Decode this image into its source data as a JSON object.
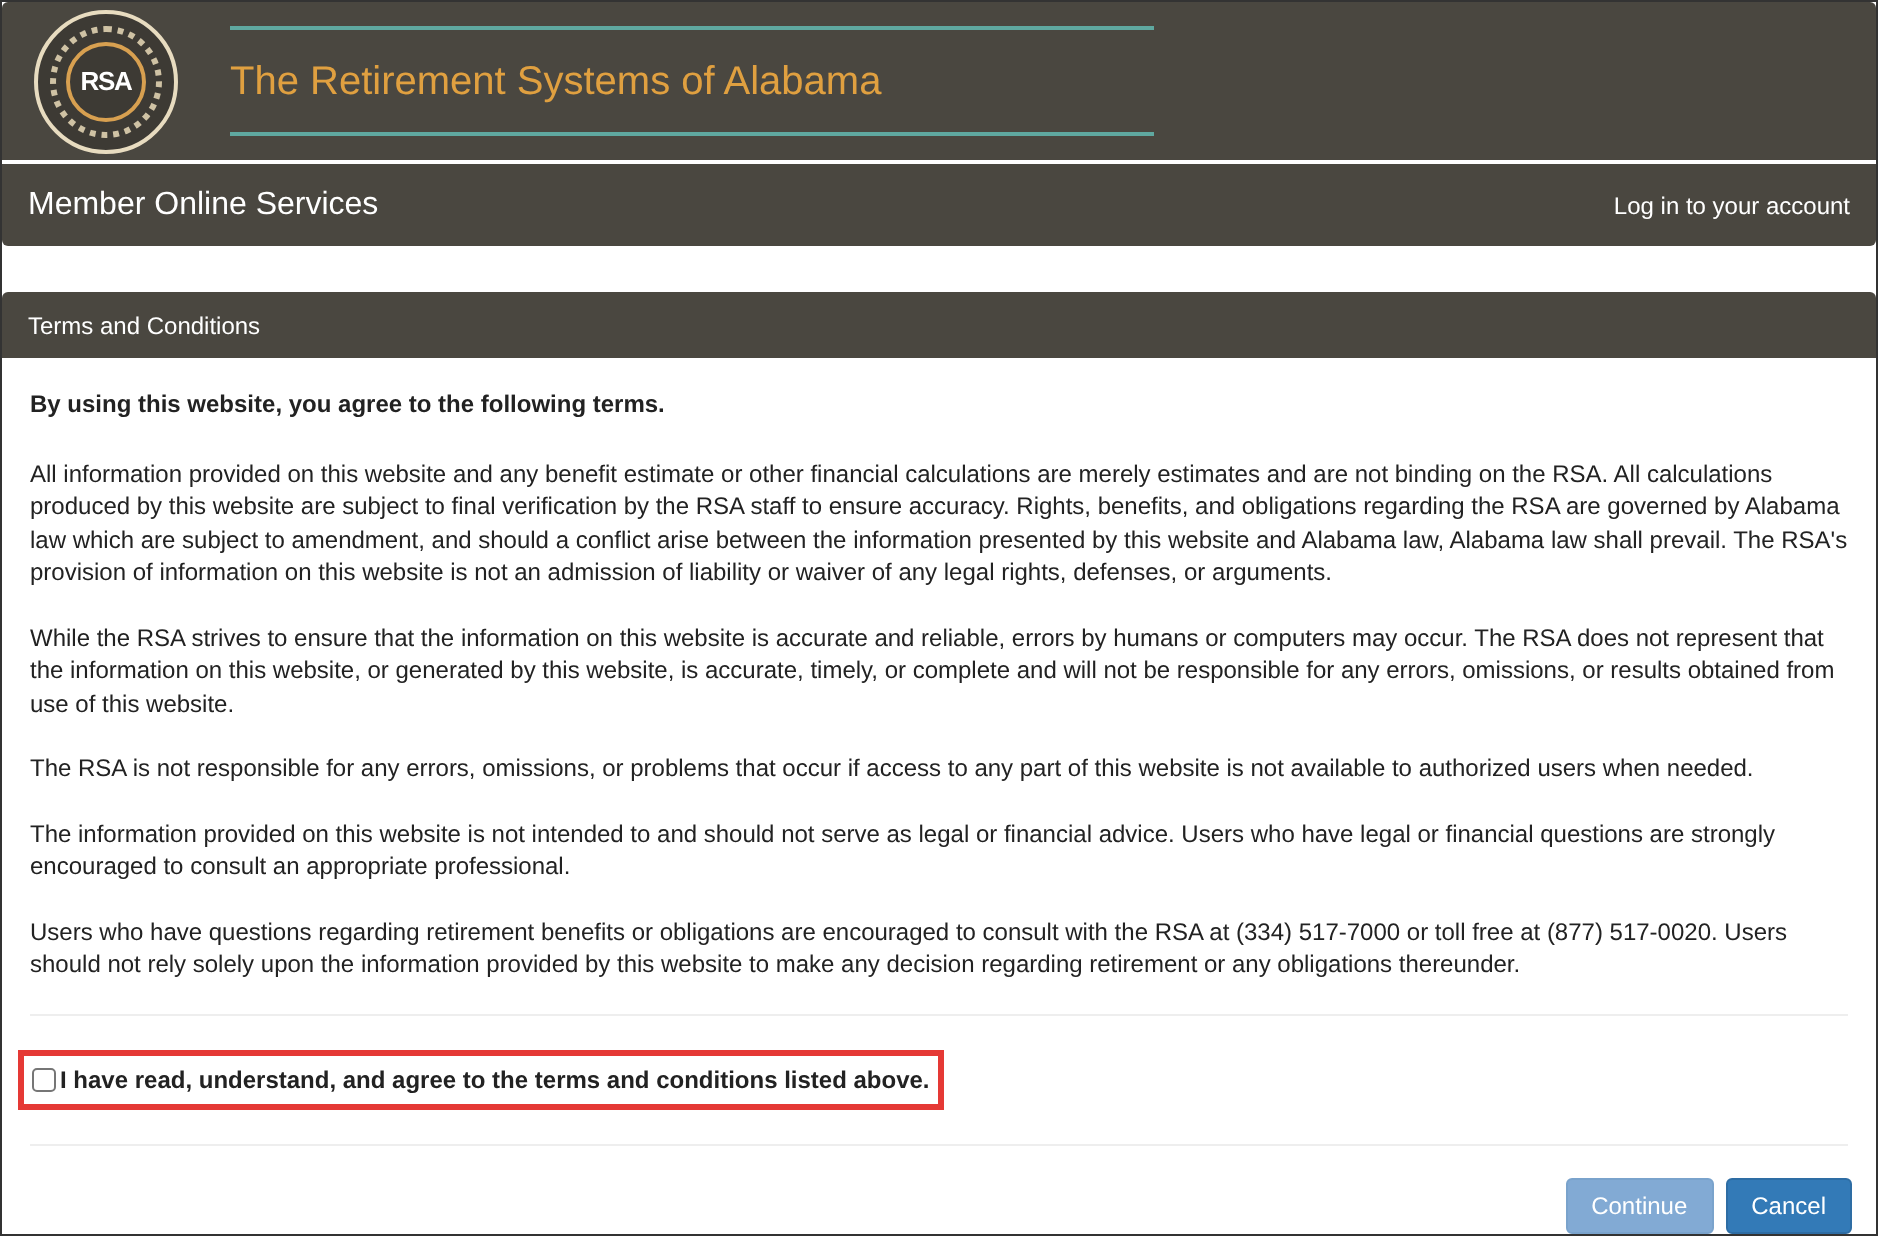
{
  "header": {
    "logo_monogram": "RSA",
    "title": "The Retirement Systems of Alabama"
  },
  "navbar": {
    "brand": "Member Online Services",
    "login_link": "Log in to your account"
  },
  "panel": {
    "title": "Terms and Conditions",
    "intro": "By using this website, you agree to the following terms.",
    "paragraphs": [
      "All information provided on this website and any benefit estimate or other financial calculations are merely estimates and are not binding on the RSA. All calculations produced by this website are subject to final verification by the RSA staff to ensure accuracy. Rights, benefits, and obligations regarding the RSA are governed by Alabama law which are subject to amendment, and should a conflict arise between the information presented by this website and Alabama law, Alabama law shall prevail. The RSA's provision of information on this website is not an admission of liability or waiver of any legal rights, defenses, or arguments.",
      "While the RSA strives to ensure that the information on this website is accurate and reliable, errors by humans or computers may occur. The RSA does not represent that the information on this website, or generated by this website, is accurate, timely, or complete and will not be responsible for any errors, omissions, or results obtained from use of this website.",
      "The RSA is not responsible for any errors, omissions, or problems that occur if access to any part of this website is not available to authorized users when needed.",
      "The information provided on this website is not intended to and should not serve as legal or financial advice. Users who have legal or financial questions are strongly encouraged to consult an appropriate professional.",
      "Users who have questions regarding retirement benefits or obligations are encouraged to consult with the RSA at (334) 517-7000 or toll free at (877) 517-0020. Users should not rely solely upon the information provided by this website to make any decision regarding retirement or any obligations thereunder."
    ],
    "agreement": {
      "label": "I have read, understand, and agree to the terms and conditions listed above.",
      "checked": false
    },
    "buttons": [
      {
        "label": "Continue",
        "kind": "primary",
        "disabled": true
      },
      {
        "label": "Cancel",
        "kind": "primary",
        "disabled": false
      }
    ]
  }
}
